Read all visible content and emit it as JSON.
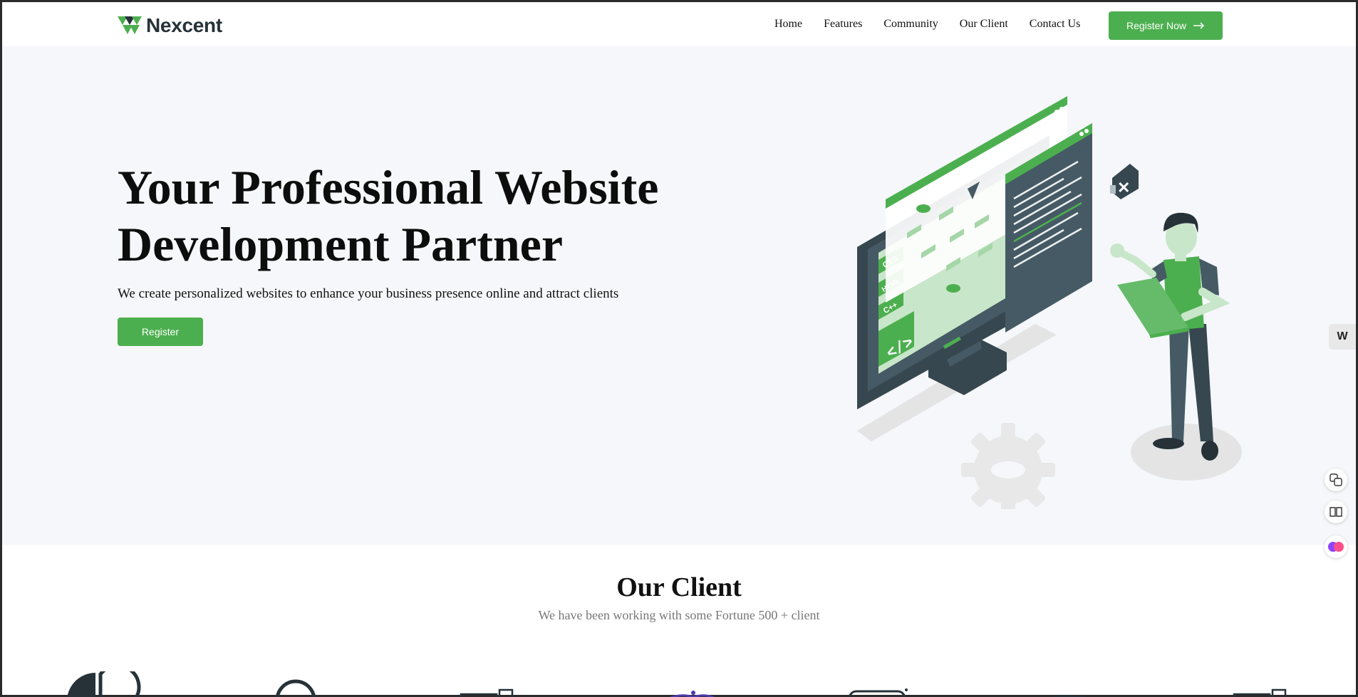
{
  "nav": {
    "brand": "Nexcent",
    "links": [
      "Home",
      "Features",
      "Community",
      "Our Client",
      "Contact Us"
    ],
    "cta": "Register Now"
  },
  "hero": {
    "title_line1": "Your Professional Website",
    "title_line2": "Development Partner",
    "subtitle": "We create personalized websites to enhance your business presence online and attract clients",
    "button": "Register",
    "illustration_labels": [
      "CSS",
      "HTML",
      "C++"
    ]
  },
  "clients": {
    "title": "Our Client",
    "subtitle": "We have been working with some Fortune 500 + client"
  },
  "side": {
    "reader_label": "W"
  },
  "colors": {
    "brand_green": "#4CAF4F",
    "dark": "#263238",
    "hero_bg": "#F5F7FA"
  }
}
